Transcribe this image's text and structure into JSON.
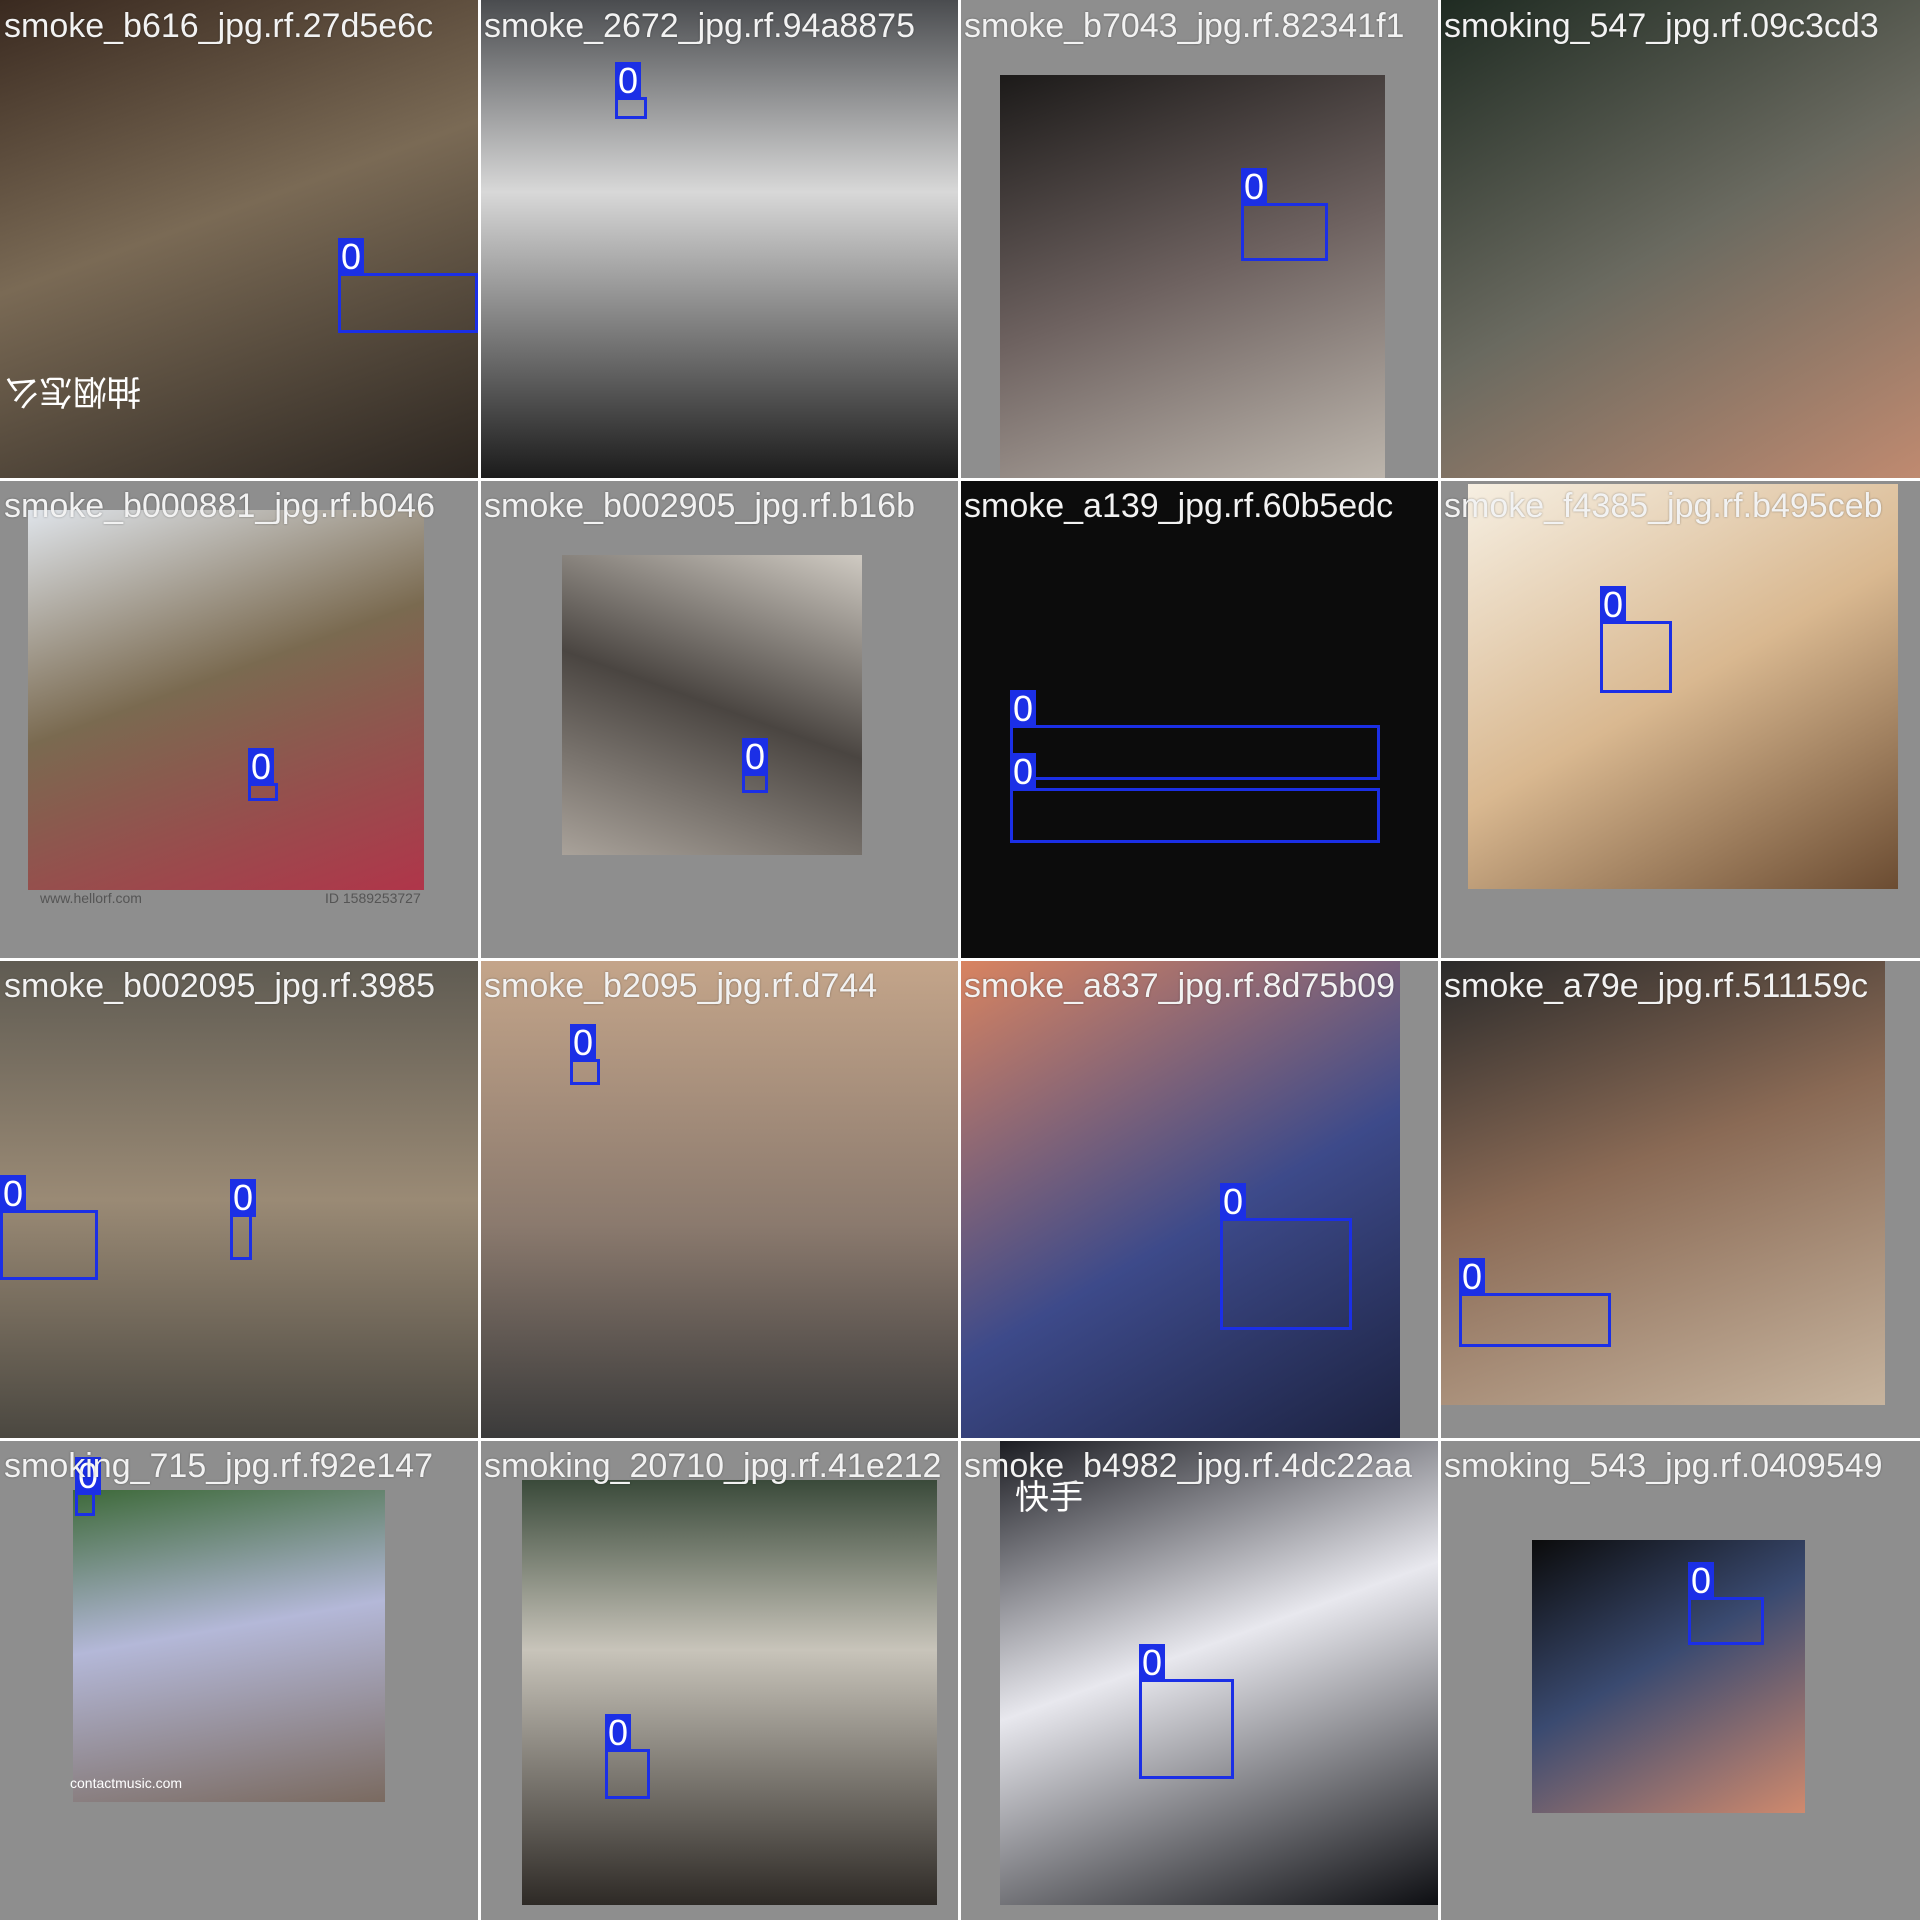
{
  "tiles": [
    {
      "caption": "smoke_b616_jpg.rf.27d5e6c",
      "bg": "#6b5a47",
      "photo": {
        "bg": "linear-gradient(160deg,#3a2a20 0%,#7a6a55 45%,#2b2520 100%)"
      },
      "boxes": [
        {
          "label": "0"
        }
      ],
      "photo_text": [
        "抽烟怎么"
      ]
    },
    {
      "caption": "smoke_2672_jpg.rf.94a8875",
      "bg": "#3b3d40",
      "photo": {
        "bg": "linear-gradient(180deg,#4a4c4f 0%,#d8d8d8 40%,#1a1a1a 100%)"
      },
      "boxes": [
        {
          "label": "0"
        }
      ]
    },
    {
      "caption": "smoke_b7043_jpg.rf.82341f1",
      "bg": "#777777",
      "photo": {
        "bg": "linear-gradient(160deg,#1c1a19 0%,#6e6260 50%,#bdb6ad 100%)"
      },
      "boxes": [
        {
          "label": "0"
        }
      ]
    },
    {
      "caption": "smoking_547_jpg.rf.09c3cd3",
      "bg": "#1e2a20",
      "photo": {
        "bg": "linear-gradient(150deg,#1f2b22 0%,#6a6a60 50%,#c08a70 100%)"
      },
      "boxes": []
    },
    {
      "caption": "smoke_b000881_jpg.rf.b046",
      "bg": "#8e8e8e",
      "photo": {
        "bg": "linear-gradient(160deg,#dfe4ea 0%,#7a6a50 45%,#b0354a 100%)"
      },
      "boxes": [
        {
          "label": "0"
        }
      ],
      "photo_text": [
        "www.hellorf.com",
        "ID 1589253727"
      ]
    },
    {
      "caption": "smoke_b002905_jpg.rf.b16b",
      "bg": "#7a7a7a",
      "photo": {
        "bg": "linear-gradient(200deg,#cfcac2 0%,#4a4541 50%,#a9a29a 100%)"
      },
      "boxes": [
        {
          "label": "0"
        }
      ]
    },
    {
      "caption": "smoke_a139_jpg.rf.60b5edc",
      "bg": "#0c0c0c",
      "photo": {
        "bg": "#0c0c0c"
      },
      "boxes": [
        {
          "label": "0"
        },
        {
          "label": "0"
        }
      ]
    },
    {
      "caption": "smoke_f4385_jpg.rf.b495ceb",
      "bg": "#7a7a7a",
      "photo": {
        "bg": "linear-gradient(150deg,#f6efe2 0%,#d9b890 50%,#6b4c32 100%)"
      },
      "boxes": [
        {
          "label": "0"
        }
      ]
    },
    {
      "caption": "smoke_b002095_jpg.rf.3985",
      "bg": "#6b675e",
      "photo": {
        "bg": "linear-gradient(180deg,#5f5b52 0%,#9a8a75 50%,#4a4740 100%)"
      },
      "boxes": [
        {
          "label": "0"
        },
        {
          "label": "0"
        }
      ]
    },
    {
      "caption": "smoke_b2095_jpg.rf.d744",
      "bg": "#b89a80",
      "photo": {
        "bg": "linear-gradient(180deg,#c4a58a 0%,#8b7a6e 55%,#3a3a3a 100%)"
      },
      "boxes": [
        {
          "label": "0"
        }
      ]
    },
    {
      "caption": "smoke_a837_jpg.rf.8d75b09",
      "bg": "#1d2a55",
      "photo": {
        "bg": "linear-gradient(150deg,#d98460 0%,#3d4a8a 55%,#1c2240 100%)"
      },
      "boxes": [
        {
          "label": "0"
        }
      ]
    },
    {
      "caption": "smoke_a79e_jpg.rf.511159c",
      "bg": "#8e8e8e",
      "photo": {
        "bg": "linear-gradient(160deg,#2a2a2a 0%,#8a6a55 45%,#c7b49e 100%)"
      },
      "boxes": [
        {
          "label": "0"
        }
      ]
    },
    {
      "caption": "smoking_715_jpg.rf.f92e147",
      "bg": "#8e8e8e",
      "photo": {
        "bg": "linear-gradient(170deg,#3e6a3a 0%,#b4b8d8 45%,#7a6a60 100%)"
      },
      "boxes": [
        {
          "label": "0"
        }
      ],
      "photo_text": [
        "contactmusic.com"
      ]
    },
    {
      "caption": "smoking_20710_jpg.rf.41e212",
      "bg": "#8e8e8e",
      "photo": {
        "bg": "linear-gradient(180deg,#3a4a3a 0%,#c8c4ba 40%,#2e2a26 100%)"
      },
      "boxes": [
        {
          "label": "0"
        }
      ]
    },
    {
      "caption": "smoke_b4982_jpg.rf.4dc22aa",
      "bg": "#0d0d10",
      "photo": {
        "bg": "linear-gradient(160deg,#1b1c22 0%,#e8e8ee 45%,#0d0e12 100%)"
      },
      "boxes": [
        {
          "label": "0"
        }
      ],
      "photo_text": [
        "快手"
      ]
    },
    {
      "caption": "smoking_543_jpg.rf.0409549",
      "bg": "#8e8e8e",
      "photo": {
        "bg": "linear-gradient(150deg,#0b0b0b 0%,#3a4a70 45%,#d08a6e 100%)"
      },
      "boxes": [
        {
          "label": "0"
        }
      ]
    }
  ],
  "colors": {
    "box": "#1b2fe6",
    "caption": "#f2f2f2",
    "divider": "#ffffff",
    "background": "#8e8e8e"
  }
}
